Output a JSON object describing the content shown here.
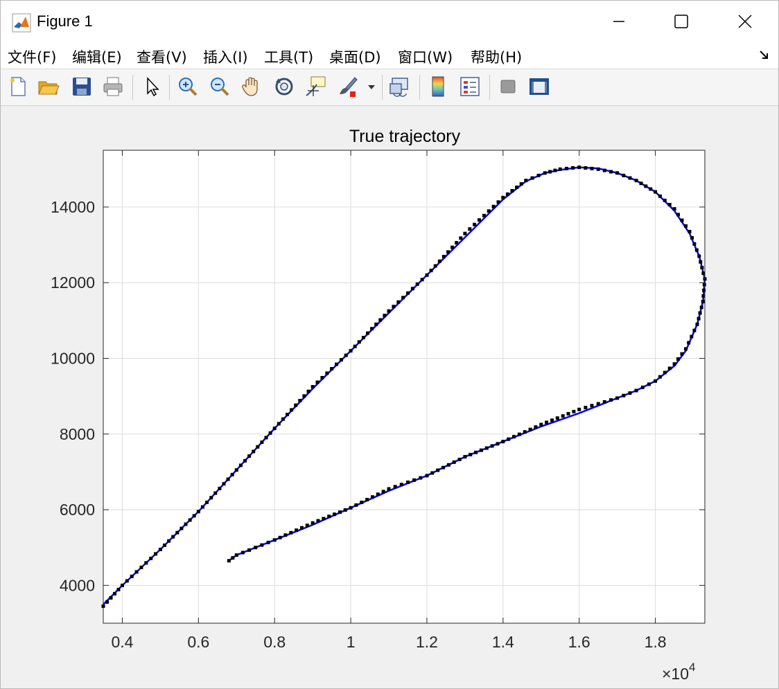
{
  "window": {
    "title": "Figure 1",
    "controls": {
      "minimize": "minimize",
      "maximize": "maximize",
      "close": "close"
    }
  },
  "menu": {
    "items": [
      {
        "label": "文件(F)"
      },
      {
        "label": "编辑(E)"
      },
      {
        "label": "查看(V)"
      },
      {
        "label": "插入(I)"
      },
      {
        "label": "工具(T)"
      },
      {
        "label": "桌面(D)"
      },
      {
        "label": "窗口(W)"
      },
      {
        "label": "帮助(H)"
      }
    ]
  },
  "toolbar": {
    "icons": [
      "new-file-icon",
      "open-folder-icon",
      "save-icon",
      "print-icon",
      "pointer-icon",
      "zoom-in-icon",
      "zoom-out-icon",
      "pan-hand-icon",
      "rotate-3d-icon",
      "data-cursor-icon",
      "brush-icon",
      "brush-dropdown-icon",
      "link-plot-icon",
      "colorbar-icon",
      "legend-icon",
      "hide-plot-tools-icon",
      "show-plot-tools-icon"
    ]
  },
  "colors": {
    "true_line": "#0000ff",
    "measured_marker": "#000000",
    "brand_orange": "#e8731a"
  },
  "chart_data": {
    "type": "line",
    "title": "True trajectory",
    "xlabel": "",
    "ylabel": "",
    "x_exponent_label": "×10",
    "x_exponent_power": "4",
    "xlim": [
      3500,
      19300
    ],
    "ylim": [
      3000,
      15500
    ],
    "xticks": [
      4000,
      6000,
      8000,
      10000,
      12000,
      14000,
      16000,
      18000
    ],
    "xtick_labels": [
      "0.4",
      "0.6",
      "0.8",
      "1",
      "1.2",
      "1.4",
      "1.6",
      "1.8"
    ],
    "yticks": [
      4000,
      6000,
      8000,
      10000,
      12000,
      14000
    ],
    "ytick_labels": [
      "4000",
      "6000",
      "8000",
      "10000",
      "12000",
      "14000"
    ],
    "grid": true,
    "series": [
      {
        "style": "line",
        "color": "#0000ff",
        "points": [
          [
            3500,
            3500
          ],
          [
            4000,
            4000
          ],
          [
            5000,
            4950
          ],
          [
            6000,
            5950
          ],
          [
            7000,
            7050
          ],
          [
            8000,
            8150
          ],
          [
            9000,
            9200
          ],
          [
            10000,
            10200
          ],
          [
            11000,
            11200
          ],
          [
            12000,
            12200
          ],
          [
            13000,
            13200
          ],
          [
            14000,
            14200
          ],
          [
            14600,
            14680
          ],
          [
            15100,
            14900
          ],
          [
            15500,
            14980
          ],
          [
            16000,
            15050
          ],
          [
            16500,
            15020
          ],
          [
            17000,
            14900
          ],
          [
            17500,
            14700
          ],
          [
            18000,
            14400
          ],
          [
            18500,
            13900
          ],
          [
            18900,
            13300
          ],
          [
            19150,
            12700
          ],
          [
            19300,
            12100
          ],
          [
            19250,
            11500
          ],
          [
            19100,
            10900
          ],
          [
            18800,
            10200
          ],
          [
            18500,
            9800
          ],
          [
            18000,
            9400
          ],
          [
            17500,
            9150
          ],
          [
            17000,
            8950
          ],
          [
            16500,
            8750
          ],
          [
            16000,
            8550
          ],
          [
            15000,
            8200
          ],
          [
            14000,
            7800
          ],
          [
            13000,
            7400
          ],
          [
            12000,
            6900
          ],
          [
            11000,
            6500
          ],
          [
            10000,
            6050
          ],
          [
            9000,
            5600
          ],
          [
            8000,
            5200
          ],
          [
            7500,
            5000
          ],
          [
            7000,
            4800
          ],
          [
            6800,
            4650
          ]
        ]
      },
      {
        "style": "markers",
        "color": "#000000",
        "marker": "square",
        "points": [
          [
            3500,
            3450
          ],
          [
            4000,
            4000
          ],
          [
            5000,
            4950
          ],
          [
            6000,
            5950
          ],
          [
            7000,
            7050
          ],
          [
            8000,
            8150
          ],
          [
            9000,
            9250
          ],
          [
            10000,
            10200
          ],
          [
            11000,
            11250
          ],
          [
            12000,
            12200
          ],
          [
            13000,
            13300
          ],
          [
            14000,
            14250
          ],
          [
            14600,
            14700
          ],
          [
            15100,
            14900
          ],
          [
            15500,
            15000
          ],
          [
            16000,
            15050
          ],
          [
            16500,
            15000
          ],
          [
            17000,
            14900
          ],
          [
            17500,
            14700
          ],
          [
            18000,
            14400
          ],
          [
            18500,
            13950
          ],
          [
            18900,
            13350
          ],
          [
            19150,
            12700
          ],
          [
            19300,
            12100
          ],
          [
            19250,
            11500
          ],
          [
            19100,
            10900
          ],
          [
            18800,
            10250
          ],
          [
            18500,
            9850
          ],
          [
            18000,
            9400
          ],
          [
            17500,
            9150
          ],
          [
            17000,
            8950
          ],
          [
            16500,
            8800
          ],
          [
            16000,
            8650
          ],
          [
            15000,
            8250
          ],
          [
            14000,
            7800
          ],
          [
            13000,
            7400
          ],
          [
            12000,
            6900
          ],
          [
            11000,
            6550
          ],
          [
            10000,
            6050
          ],
          [
            9000,
            5650
          ],
          [
            8000,
            5200
          ],
          [
            7500,
            5000
          ],
          [
            7000,
            4800
          ],
          [
            6800,
            4650
          ]
        ]
      }
    ]
  }
}
